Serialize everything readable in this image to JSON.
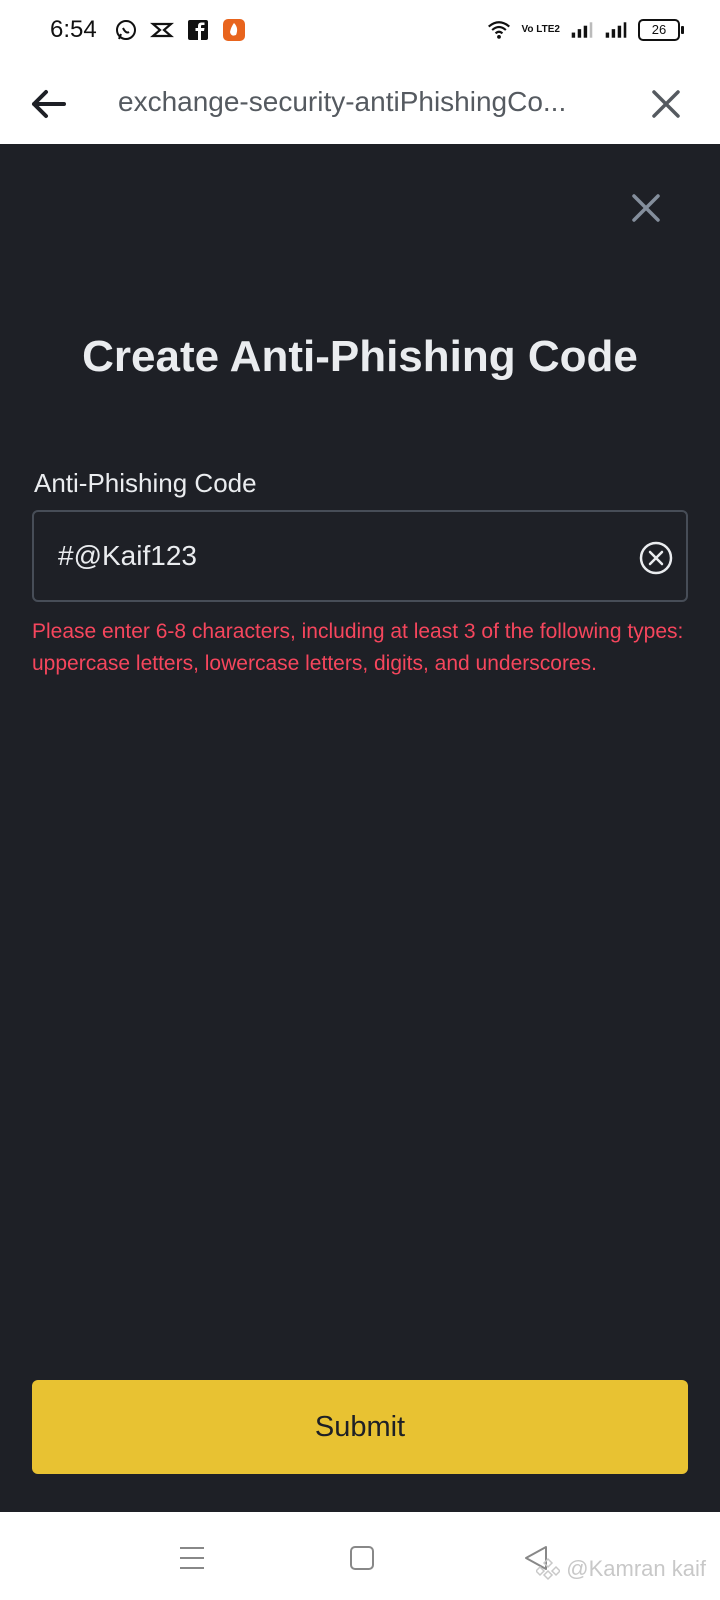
{
  "status_bar": {
    "time": "6:54",
    "left_icons": [
      "whatsapp-business-icon",
      "capcut-icon",
      "facebook-icon",
      "app-notification-icon"
    ],
    "network_label": "Vo LTE2",
    "battery_level": "26"
  },
  "browser": {
    "url": "exchange-security-antiPhishingCo..."
  },
  "modal": {
    "title": "Create Anti-Phishing Code",
    "field_label": "Anti-Phishing Code",
    "input_value": "#@Kaif123",
    "error_message": "Please enter 6-8 characters, including at least 3 of the following types: uppercase letters, lowercase letters, digits, and underscores.",
    "submit_label": "Submit"
  },
  "watermark": {
    "text": "@Kamran kaif"
  },
  "colors": {
    "background_dark": "#1e2026",
    "accent_yellow": "#e8c232",
    "error_red": "#f6465d",
    "text_light": "#eaecef"
  }
}
